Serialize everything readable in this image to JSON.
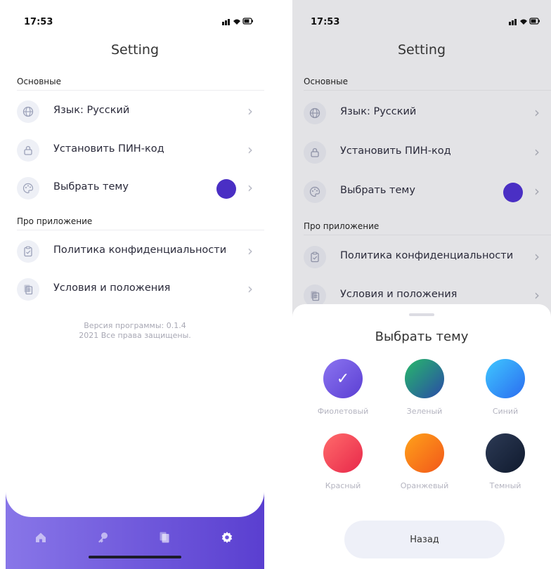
{
  "status": {
    "time": "17:53",
    "icons": "··| • ▮"
  },
  "header": {
    "title": "Setting"
  },
  "sections": {
    "main": "Основные",
    "about": "Про приложение"
  },
  "rows": {
    "language": {
      "label": "Язык: Русский",
      "icon": "globe-icon"
    },
    "pin": {
      "label": "Установить ПИН-код",
      "icon": "lock-icon"
    },
    "theme": {
      "label": "Выбрать тему",
      "icon": "palette-icon",
      "current_color": "#4a2fc4"
    },
    "privacy": {
      "label": "Политика конфиденциальности",
      "icon": "clipboard-icon"
    },
    "terms": {
      "label": "Условия и положения",
      "icon": "document-icon"
    }
  },
  "version": {
    "line1": "Версия программы: 0.1.4",
    "line2": "2021 Все права защищены."
  },
  "bottom_nav": {
    "items": [
      "home-icon",
      "key-icon",
      "documents-icon",
      "gear-icon"
    ],
    "active": "gear-icon",
    "gradient": [
      "#8876e8",
      "#5a3fd0"
    ]
  },
  "theme_sheet": {
    "title": "Выбрать тему",
    "selected": "violet",
    "themes": [
      {
        "key": "violet",
        "label": "Фиолетовый",
        "colors": [
          "#8b74f0",
          "#5b3fd3"
        ]
      },
      {
        "key": "green",
        "label": "Зеленый",
        "colors": [
          "#27b96a",
          "#2a4aa8"
        ]
      },
      {
        "key": "blue",
        "label": "Синий",
        "colors": [
          "#3fc7ff",
          "#2b6cf0"
        ]
      },
      {
        "key": "red",
        "label": "Красный",
        "colors": [
          "#ff6b6b",
          "#e8284a"
        ]
      },
      {
        "key": "orange",
        "label": "Оранжевый",
        "colors": [
          "#ffa21a",
          "#f2571a"
        ]
      },
      {
        "key": "dark",
        "label": "Темный",
        "colors": [
          "#2c3a55",
          "#101a2e"
        ]
      }
    ],
    "back_label": "Назад",
    "check_glyph": "✓"
  }
}
